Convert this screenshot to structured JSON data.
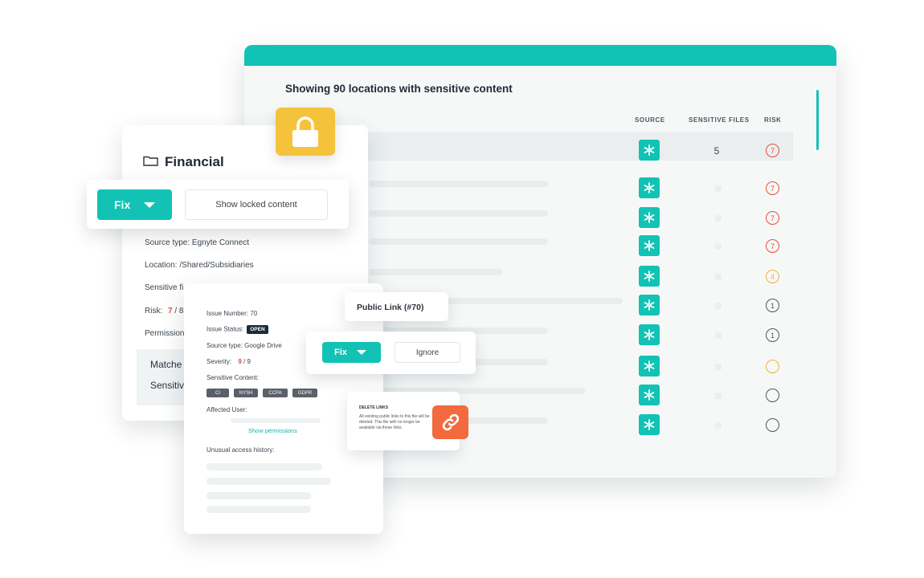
{
  "table": {
    "title": "Showing 90 locations with sensitive content",
    "col_source": "SOURCE",
    "col_sensitive": "SENSITIVE FILES",
    "col_risk": "RISK",
    "rows": [
      {
        "sensitive": "5",
        "risk": "7",
        "risk_color": "#e84b3c"
      },
      {
        "sensitive": "",
        "risk": "7",
        "risk_color": "#e84b3c"
      },
      {
        "sensitive": "",
        "risk": "7",
        "risk_color": "#e84b3c"
      },
      {
        "sensitive": "",
        "risk": "7",
        "risk_color": "#e84b3c"
      },
      {
        "sensitive": "",
        "risk": "4",
        "risk_color": "#f0b429"
      },
      {
        "sensitive": "",
        "risk": "1",
        "risk_color": "#555555"
      },
      {
        "sensitive": "",
        "risk": "1",
        "risk_color": "#555555"
      },
      {
        "sensitive": "",
        "risk": "",
        "risk_color": "#f0b429"
      },
      {
        "sensitive": "",
        "risk": "",
        "risk_color": "#555555"
      },
      {
        "sensitive": "",
        "risk": "",
        "risk_color": "#555555"
      }
    ]
  },
  "folder": {
    "title": "Financial",
    "fix_label": "Fix",
    "show_locked_label": "Show locked content",
    "source_type": "Source type: Egnyte Connect",
    "location": "Location: /Shared/Subsidiaries",
    "sensitive": "Sensitive fi",
    "risk_label": "Risk:",
    "risk_value": "7",
    "risk_total": "/ 8",
    "permissions": "Permission",
    "matches": "Matche",
    "sensitive2": "Sensitiv"
  },
  "issue": {
    "number": "Issue Number:  70",
    "status_label": "Issue Status:",
    "status_value": "OPEN",
    "source_type": "Source type:   Google Drive",
    "severity_label": "Severity:",
    "severity_value": "9",
    "severity_total": "/ 9",
    "sensitive_content": "Sensitive Content:",
    "tags": [
      "CI",
      "NYSH",
      "CCPA",
      "GDPR"
    ],
    "affected_user": "Affected User:",
    "show_permissions": "Show permissions",
    "unusual_access": "Unusual access history:"
  },
  "action": {
    "public_link": "Public Link (#70)",
    "fix_label": "Fix",
    "ignore_label": "Ignore",
    "delete_title": "DELETE LINKS",
    "delete_desc": "All existing public links to this file will be deleted. This file with no longer be available via these links."
  },
  "colors": {
    "accent": "#12c2b5",
    "lock": "#f5c33b",
    "link": "#f26a3d",
    "danger": "#e84b3c",
    "warning": "#f0b429"
  }
}
